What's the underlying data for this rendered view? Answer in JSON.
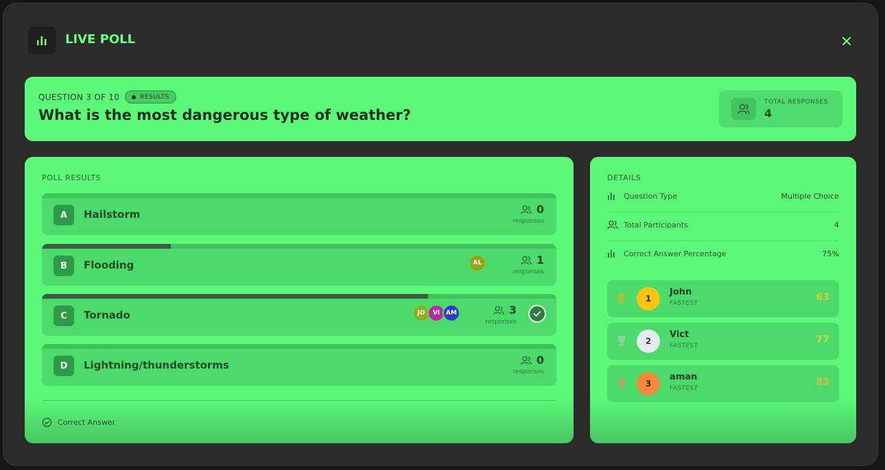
{
  "header": {
    "title": "LIVE POLL",
    "icon": "bar-chart-icon",
    "close_icon": "close-icon"
  },
  "question": {
    "counter": "QUESTION 3 OF 10",
    "badge": "RESULTS",
    "text": "What is the most dangerous type of weather?",
    "total_responses_label": "TOTAL RESPONSES",
    "total_responses_value": "4"
  },
  "results": {
    "label": "POLL RESULTS",
    "responses_word": "responses",
    "options": [
      {
        "letter": "A",
        "text": "Hailstorm",
        "count": "0",
        "fraction": 0,
        "voters": []
      },
      {
        "letter": "B",
        "text": "Flooding",
        "count": "1",
        "fraction": 0.25,
        "voters": [
          {
            "initials": "AL",
            "color": "#9aa31a"
          }
        ]
      },
      {
        "letter": "C",
        "text": "Tornado",
        "count": "3",
        "fraction": 0.75,
        "correct": true,
        "voters": [
          {
            "initials": "JO",
            "color": "#8fb01c"
          },
          {
            "initials": "VI",
            "color": "#b52c9f"
          },
          {
            "initials": "AM",
            "color": "#2c3fc4"
          }
        ]
      },
      {
        "letter": "D",
        "text": "Lightning/thunderstorms",
        "count": "0",
        "fraction": 0,
        "voters": []
      }
    ],
    "legend": "Correct Answer"
  },
  "details": {
    "label": "DETAILS",
    "rows": [
      {
        "key": "Question Type",
        "value": "Multiple Choice",
        "icon": "bar-chart-icon"
      },
      {
        "key": "Total Participants",
        "value": "4",
        "icon": "users-icon"
      },
      {
        "key": "Correct Answer Percentage",
        "value": "75%",
        "icon": "bar-chart-icon"
      }
    ],
    "leaderboard": [
      {
        "rank": "1",
        "name": "John",
        "sub": "FASTEST",
        "score": "63",
        "rank_color": "#ffc312",
        "score_color": "#d9c83a"
      },
      {
        "rank": "2",
        "name": "Vict",
        "sub": "FASTEST",
        "score": "77",
        "rank_color": "#e6e9ee",
        "score_color": "#c9d64a"
      },
      {
        "rank": "3",
        "name": "aman",
        "sub": "FASTEST",
        "score": "83",
        "rank_color": "#f7873a",
        "score_color": "#d8b845"
      }
    ]
  },
  "colors": {
    "accent": "#5cf879",
    "background": "#2b2b2b",
    "title": "#6dff80"
  }
}
